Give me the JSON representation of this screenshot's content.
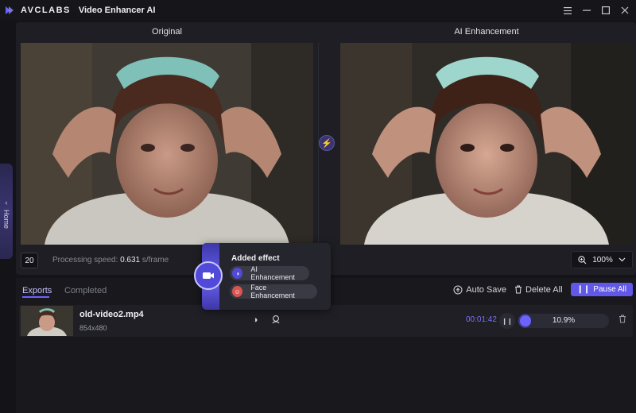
{
  "app": {
    "brand": "AVCLABS",
    "name": "Video Enhancer AI"
  },
  "window_controls": {
    "menu_icon": "menu-icon",
    "minimize_icon": "minimize-icon",
    "maximize_icon": "maximize-icon",
    "close_icon": "close-icon"
  },
  "side": {
    "label": "Home"
  },
  "preview": {
    "original_title": "Original",
    "enhanced_title": "AI Enhancement",
    "frame_value": "20",
    "speed_label": "Processing speed:",
    "speed_value": "0.631",
    "speed_unit": "s/frame",
    "zoom_value": "100%"
  },
  "tabs": {
    "exports": "Exports",
    "completed": "Completed"
  },
  "toolbar": {
    "auto_save": "Auto Save",
    "delete_all": "Delete All",
    "pause_all": "Pause All"
  },
  "job": {
    "file_name": "old-video2.mp4",
    "resolution": "854x480",
    "elapsed": "00:01:42",
    "progress_text": "10.9%",
    "progress_fraction": 0.109
  },
  "popup": {
    "title": "Added effect",
    "effects": [
      "AI Enhancement",
      "Face Enhancement"
    ]
  },
  "colors": {
    "accent": "#6c63ff",
    "background": "#141418",
    "panel": "#1e1e24"
  }
}
